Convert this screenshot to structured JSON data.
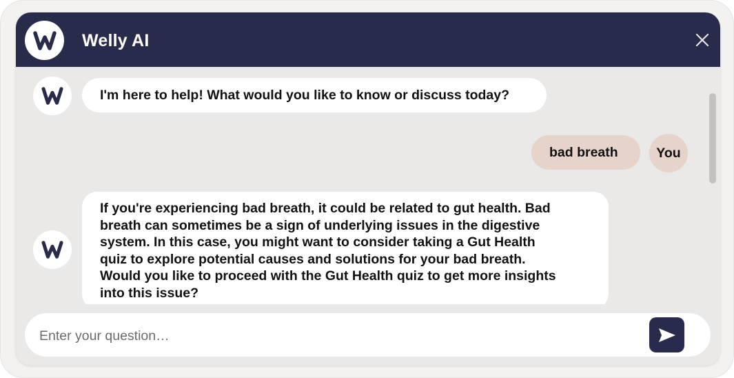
{
  "header": {
    "title": "Welly AI",
    "logo_icon": "welly-w-logo",
    "close_icon": "close-icon"
  },
  "messages": [
    {
      "sender": "assistant",
      "text": "I'm here to help! What would you like to know or discuss today?"
    },
    {
      "sender": "user",
      "text": "bad breath",
      "avatar_label": "You"
    },
    {
      "sender": "assistant",
      "lines": [
        "If you're experiencing bad breath, it could be related to gut health. Bad",
        "breath can sometimes be a sign of underlying issues in the digestive",
        "system. In this case, you might want to consider taking a Gut Health",
        "quiz to explore potential causes and solutions for your bad breath.",
        "Would you like to proceed with the Gut Health quiz to get more insights",
        "into this issue?"
      ]
    }
  ],
  "composer": {
    "placeholder": "Enter your question…",
    "value": "",
    "send_icon": "send-icon"
  },
  "colors": {
    "header_bg": "#292b4b",
    "chat_bg": "#ebe9e7",
    "user_bubble": "#e6d3ca",
    "assistant_bubble": "#ffffff",
    "send_button": "#292b4b"
  }
}
